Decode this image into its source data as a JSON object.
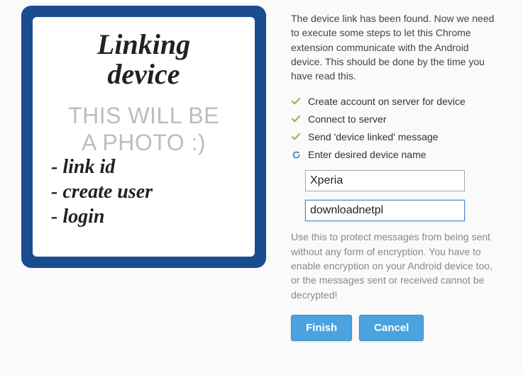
{
  "photo": {
    "title_line1": "Linking",
    "title_line2": "device",
    "watermark_line1": "THIS WILL BE",
    "watermark_line2": "A PHOTO :)",
    "list": [
      "- link id",
      "- create user",
      "- login"
    ]
  },
  "intro": "The device link has been found. Now we need to execute some steps to let this Chrome extension communicate with the Android device. This should be done by the time you have read this.",
  "steps": [
    {
      "status": "done",
      "label": "Create account on server for device"
    },
    {
      "status": "done",
      "label": "Connect to server"
    },
    {
      "status": "done",
      "label": "Send 'device linked' message"
    },
    {
      "status": "pending",
      "label": "Enter desired device name"
    }
  ],
  "inputs": {
    "deviceName": "Xperia",
    "password": "downloadnetpl"
  },
  "helper": "Use this to protect messages from being sent without any form of encryption. You have to enable encryption on your Android device too, or the messages sent or received cannot be decrypted!",
  "buttons": {
    "finish": "Finish",
    "cancel": "Cancel"
  },
  "colors": {
    "accent": "#4aa3df",
    "frame": "#1a4d8f",
    "check": "#8fbe4a",
    "spin": "#3a7fbf"
  }
}
